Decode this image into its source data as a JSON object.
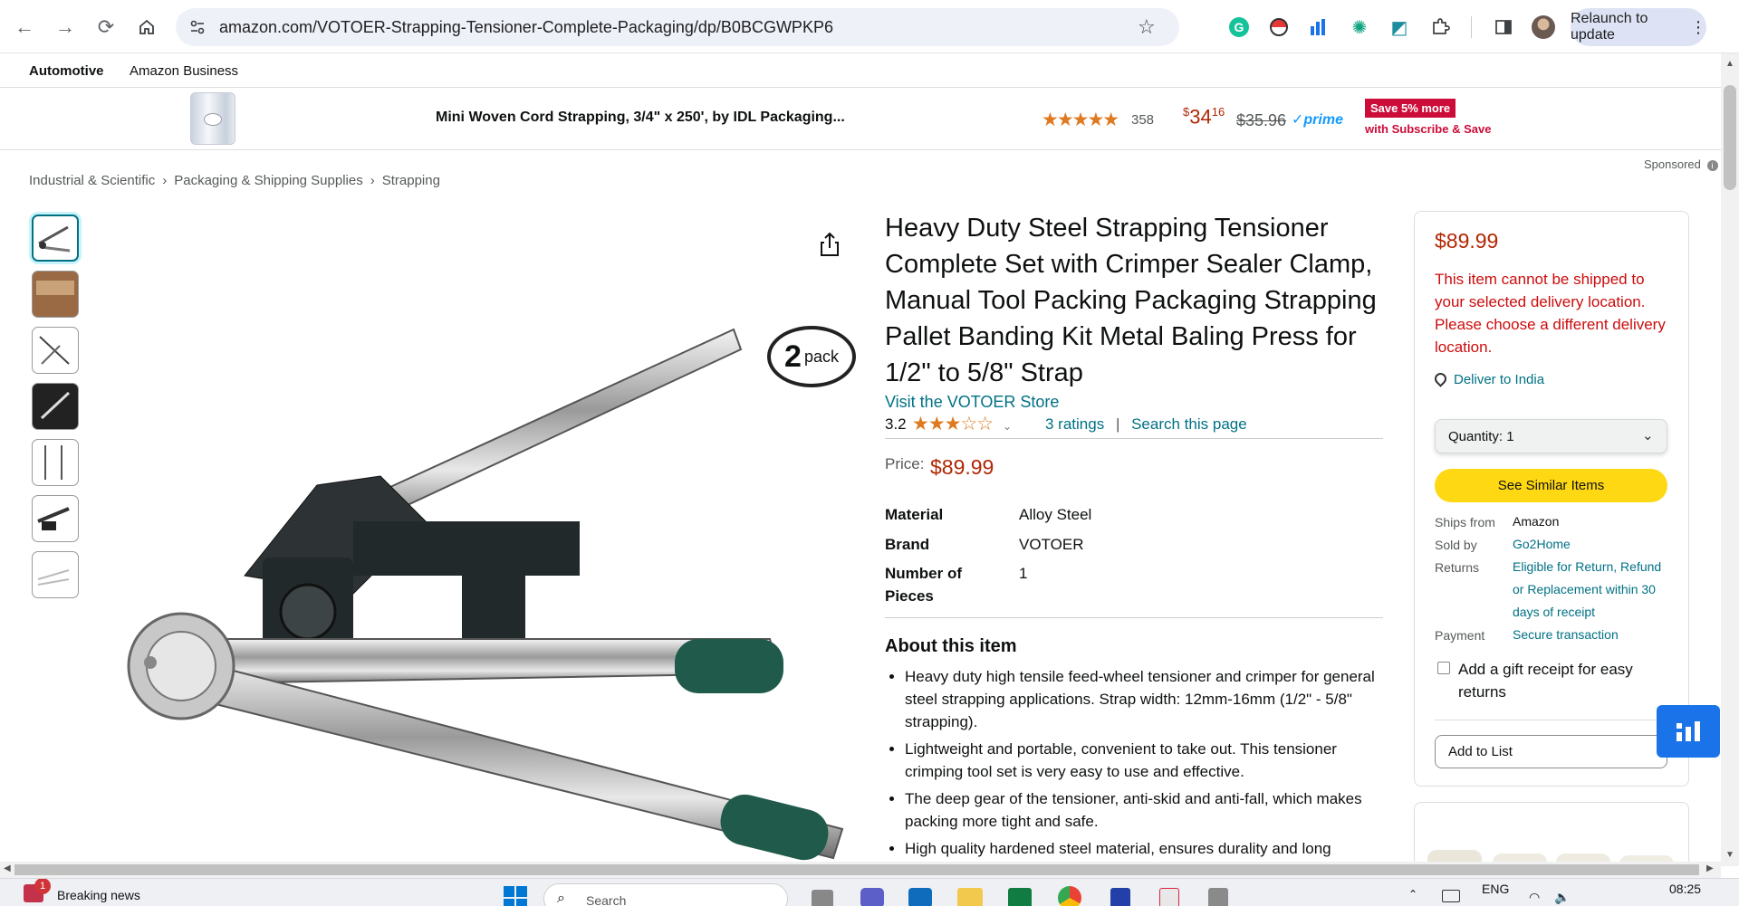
{
  "browser": {
    "url": "amazon.com/VOTOER-Strapping-Tensioner-Complete-Packaging/dp/B0BCGWPKP6",
    "relaunch_label": "Relaunch to update"
  },
  "subnav": {
    "items": [
      "Automotive",
      "Amazon Business"
    ]
  },
  "sponsored_bar": {
    "title": "Mini Woven Cord Strapping, 3/4\" x 250', by IDL Packaging...",
    "stars": "★★★★★",
    "rating_count": "358",
    "price_symbol": "$",
    "price_whole": "34",
    "price_fraction": "16",
    "list_price": "$35.96",
    "prime": "✓prime",
    "badge": "Save 5% more",
    "badge_sub": "with Subscribe & Save",
    "sponsored_label": "Sponsored"
  },
  "breadcrumb": [
    "Industrial & Scientific",
    "Packaging & Shipping Supplies",
    "Strapping"
  ],
  "product": {
    "title": "Heavy Duty Steel Strapping Tensioner Complete Set with Crimper Sealer Clamp, Manual Tool Packing Packaging Strapping Pallet Banding Kit Metal Baling Press for 1/2\" to 5/8\" Strap",
    "store_link": "Visit the VOTOER Store",
    "rating": "3.2",
    "rating_value": 3.2,
    "stars": "★★★☆☆",
    "ratings_link": "3 ratings",
    "search_link": "Search this page",
    "price_label": "Price:",
    "price": "$89.99",
    "pack_badge_num": "2",
    "pack_badge_word": "pack",
    "specs": [
      {
        "key": "Material",
        "value": "Alloy Steel"
      },
      {
        "key": "Brand",
        "value": "VOTOER"
      },
      {
        "key": "Number of Pieces",
        "value": "1"
      }
    ],
    "about_heading": "About this item",
    "bullets": [
      "Heavy duty high tensile feed-wheel tensioner and crimper for general steel strapping applications. Strap width: 12mm-16mm (1/2\" - 5/8\" strapping).",
      "Lightweight and portable, convenient to take out. This tensioner crimping tool set is very easy to use and effective.",
      "The deep gear of the tensioner, anti-skid and anti-fall, which makes packing more tight and safe.",
      "High quality hardened steel material, ensures durality and long"
    ]
  },
  "buybox": {
    "price": "$89.99",
    "warning": "This item cannot be shipped to your selected delivery location. Please choose a different delivery location.",
    "deliver": "Deliver to India",
    "quantity": "Quantity:  1",
    "see_similar": "See Similar Items",
    "details": [
      {
        "key": "Ships from",
        "value": "Amazon"
      },
      {
        "key": "Sold by",
        "value": "Go2Home"
      },
      {
        "key": "Returns",
        "value": "Eligible for Return, Refund or Replacement within 30 days of receipt"
      },
      {
        "key": "Payment",
        "value": "Secure transaction"
      }
    ],
    "gift": "Add a gift receipt for easy returns",
    "add_to_list": "Add to List"
  },
  "taskbar": {
    "news_badge": "1",
    "news": "Breaking news",
    "search": "Search",
    "lang": "ENG",
    "time": "08:25"
  },
  "colors": {
    "accent": "#007185",
    "price": "#b12704",
    "buy_button": "#ffd814",
    "star": "#de7921"
  }
}
